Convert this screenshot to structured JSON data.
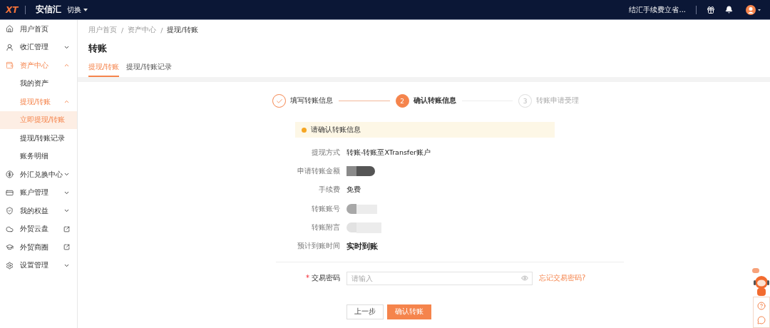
{
  "header": {
    "logo": "XT",
    "brand": "安信汇",
    "switch": "切换",
    "notice": "结汇手续费立省..."
  },
  "sidebar": {
    "items": [
      {
        "label": "用户首页",
        "kind": "plain",
        "selected": false
      },
      {
        "label": "收汇管理",
        "kind": "group",
        "selected": false,
        "expanded": false
      },
      {
        "label": "资产中心",
        "kind": "group",
        "selected": true,
        "expanded": true,
        "children": [
          {
            "label": "我的资产",
            "kind": "plain",
            "selected": false
          },
          {
            "label": "提现/转账",
            "kind": "group",
            "selected": true,
            "expanded": true,
            "children": [
              {
                "label": "立即提现/转账",
                "kind": "plain",
                "selected": true
              },
              {
                "label": "提现/转账记录",
                "kind": "plain",
                "selected": false
              }
            ]
          },
          {
            "label": "账务明细",
            "kind": "plain",
            "selected": false
          }
        ]
      },
      {
        "label": "外汇兑换中心",
        "kind": "group",
        "selected": false,
        "expanded": false
      },
      {
        "label": "账户管理",
        "kind": "group",
        "selected": false,
        "expanded": false
      },
      {
        "label": "我的权益",
        "kind": "group",
        "selected": false,
        "expanded": false
      },
      {
        "label": "外贸云盘",
        "kind": "external",
        "selected": false
      },
      {
        "label": "外贸商圈",
        "kind": "external",
        "selected": false
      },
      {
        "label": "设置管理",
        "kind": "group",
        "selected": false,
        "expanded": false
      }
    ]
  },
  "breadcrumb": {
    "separator": "/",
    "items": [
      "用户首页",
      "资产中心",
      "提现/转账"
    ]
  },
  "page_title": "转账",
  "tabs": [
    {
      "label": "提现/转账",
      "selected": true
    },
    {
      "label": "提现/转账记录",
      "selected": false
    }
  ],
  "steps": [
    {
      "label": "填写转账信息",
      "done": true,
      "selected": false
    },
    {
      "number": "2",
      "label": "确认转账信息",
      "done": false,
      "selected": true
    },
    {
      "number": "3",
      "label": "转账申请受理",
      "done": false,
      "selected": false
    }
  ],
  "alert": "请确认转账信息",
  "details": [
    {
      "label": "提现方式",
      "kind": "text",
      "value": "转账-转账至XTransfer账户"
    },
    {
      "label": "申请转账金额",
      "kind": "redacted"
    },
    {
      "label": "手续费",
      "kind": "text",
      "value": "免费"
    },
    {
      "label": "转账账号",
      "kind": "redacted"
    },
    {
      "label": "转账附言",
      "kind": "redacted"
    },
    {
      "label": "预计到账时间",
      "kind": "strong",
      "value": "实时到账"
    }
  ],
  "password": {
    "label": "交易密码",
    "required_mark": "*",
    "placeholder": "请输入",
    "link": "忘记交易密码?"
  },
  "buttons": [
    {
      "label": "上一步",
      "kind": "default"
    },
    {
      "label": "确认转账",
      "kind": "primary"
    }
  ]
}
